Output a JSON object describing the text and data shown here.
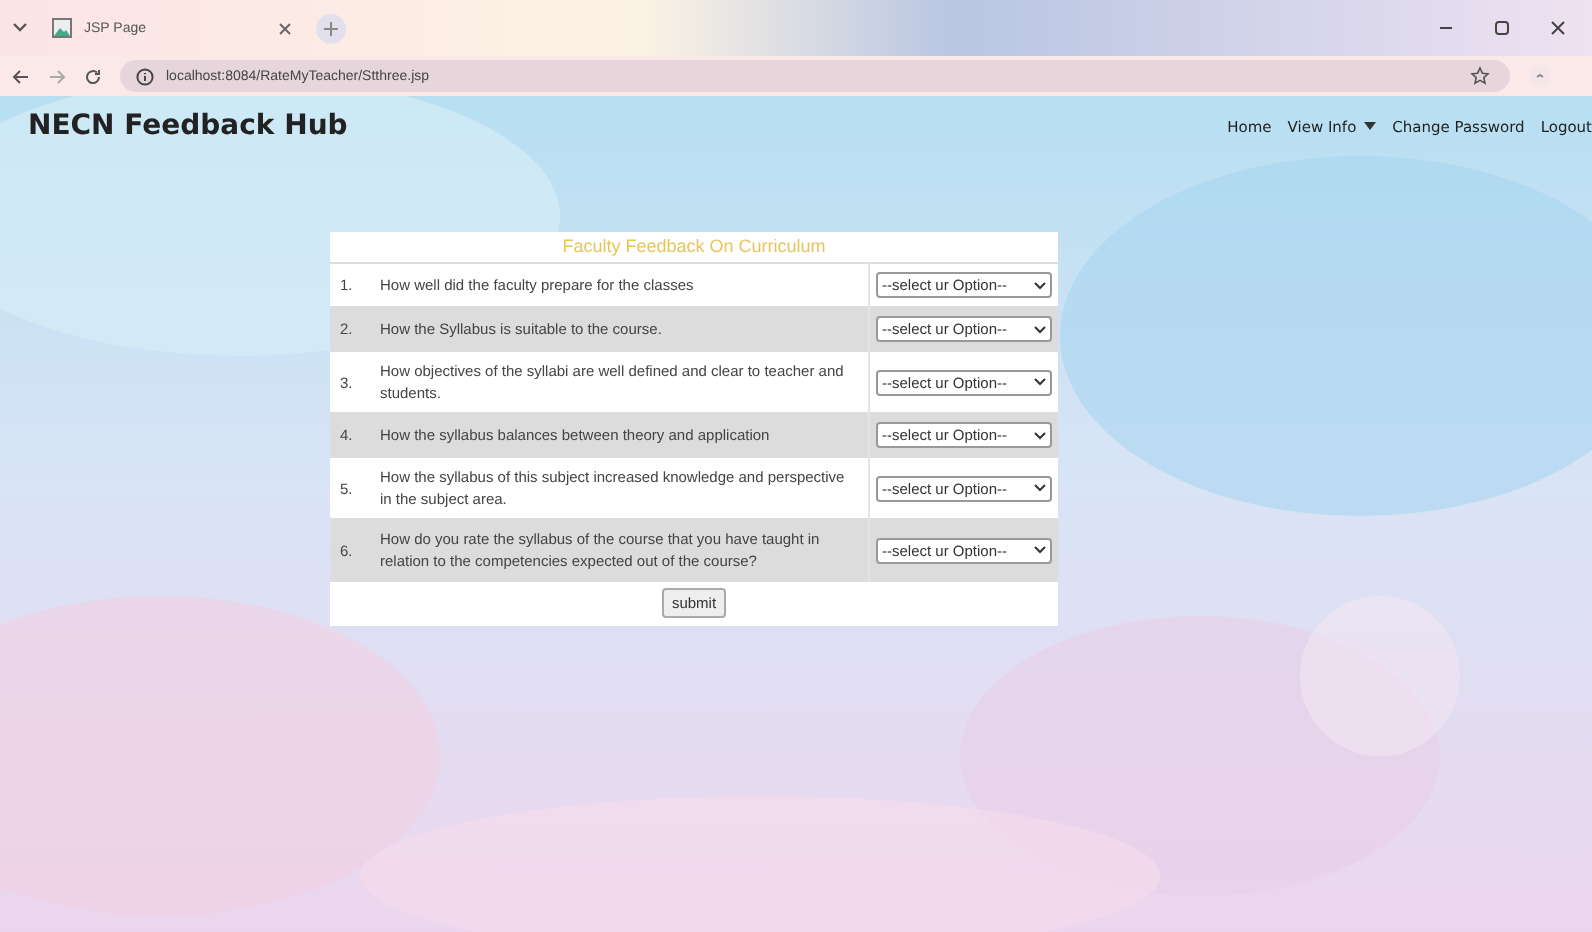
{
  "browser": {
    "tab_title": "JSP Page",
    "url": "localhost:8084/RateMyTeacher/Stthree.jsp"
  },
  "site": {
    "brand": "NECN Feedback Hub",
    "nav": [
      {
        "label": "Home",
        "kind": "link"
      },
      {
        "label": "View Info",
        "kind": "dropdown"
      },
      {
        "label": "Change Password",
        "kind": "link"
      },
      {
        "label": "Logout",
        "kind": "link"
      }
    ]
  },
  "form": {
    "title": "Faculty Feedback On Curriculum",
    "questions": [
      {
        "number": "1.",
        "text": "How well did the faculty prepare for the classes",
        "option": "--select ur Option--"
      },
      {
        "number": "2.",
        "text": "How the Syllabus is suitable to the course.",
        "option": "--select ur Option--"
      },
      {
        "number": "3.",
        "text": "How objectives of the syllabi are well defined and clear to teacher and students.",
        "option": "--select ur Option--"
      },
      {
        "number": "4.",
        "text": "How the syllabus balances between theory and application",
        "option": "--select ur Option--"
      },
      {
        "number": "5.",
        "text": "How the syllabus of this subject increased knowledge and perspective in the subject area.",
        "option": "--select ur Option--"
      },
      {
        "number": "6.",
        "text": "How do you rate the syllabus of the course that you have taught in relation to the competencies expected out of the course?",
        "option": "--select ur Option--"
      }
    ],
    "submit": "submit"
  }
}
